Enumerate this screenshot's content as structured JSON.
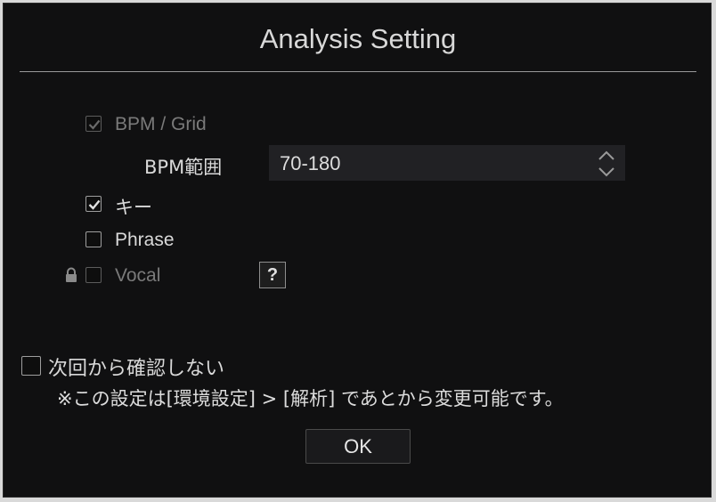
{
  "dialog": {
    "title": "Analysis Setting"
  },
  "options": {
    "bpm_grid": {
      "label": "BPM / Grid",
      "checked": true,
      "enabled": false
    },
    "bpm_range": {
      "label": "BPM範囲",
      "value": "70-180"
    },
    "key": {
      "label": "キー",
      "checked": true,
      "enabled": true
    },
    "phrase": {
      "label": "Phrase",
      "checked": false,
      "enabled": true
    },
    "vocal": {
      "label": "Vocal",
      "checked": false,
      "enabled": false,
      "locked": true,
      "help": "?"
    }
  },
  "footer": {
    "dont_ask_label": "次回から確認しない",
    "dont_ask_checked": false,
    "note": "※この設定は[環境設定] > [解析] であとから変更可能です。",
    "ok_label": "OK"
  },
  "icons": {
    "lock": "lock-icon",
    "help": "help-icon",
    "spinner": "up-down-arrows-icon",
    "check": "checkmark-icon"
  }
}
